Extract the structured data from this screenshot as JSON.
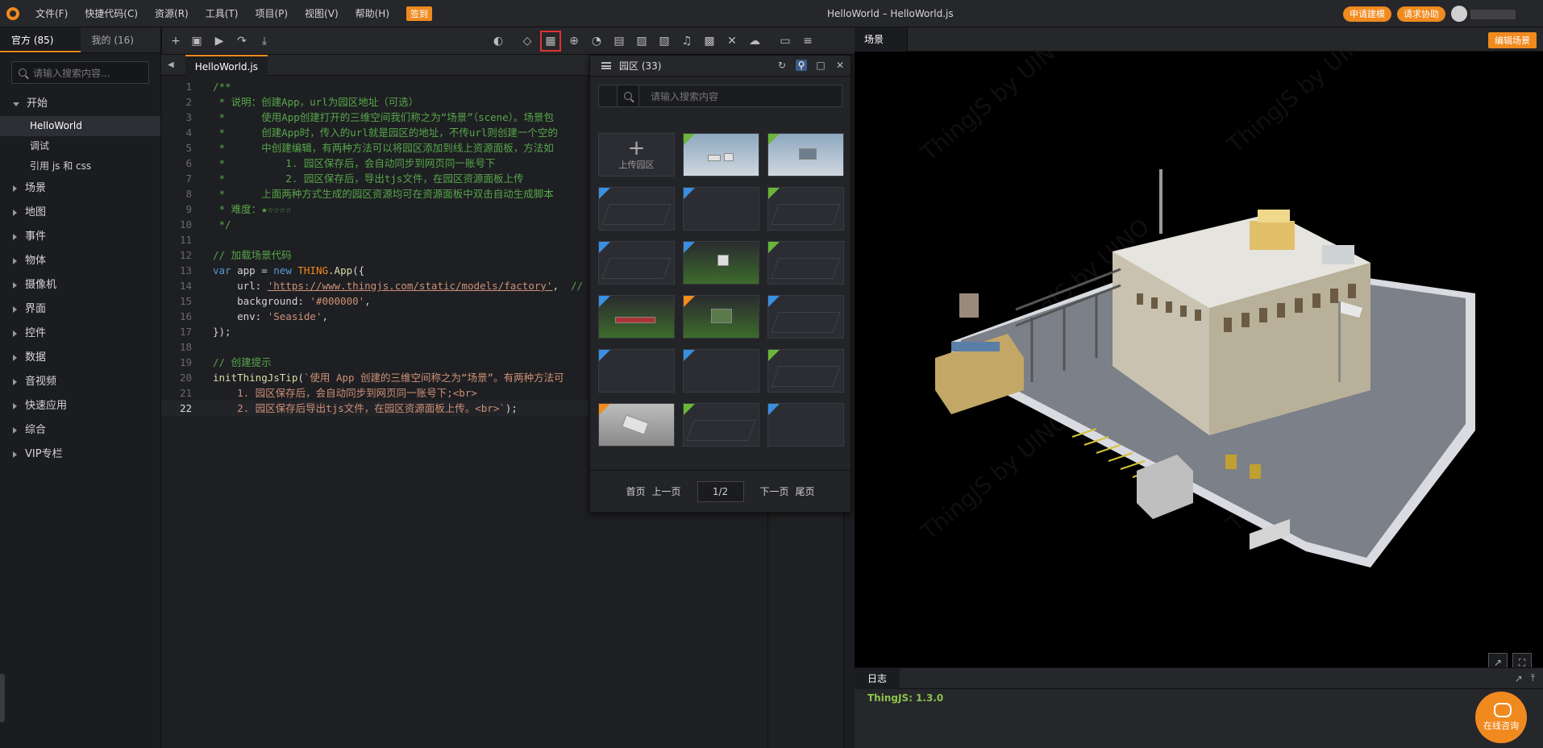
{
  "menubar": {
    "items": [
      "文件(F)",
      "快捷代码(C)",
      "资源(R)",
      "工具(T)",
      "项目(P)",
      "视图(V)",
      "帮助(H)"
    ],
    "signin": "签到",
    "title": "HelloWorld –  HelloWorld.js",
    "apply_build": "申请建模",
    "ask_help": "请求协助"
  },
  "sidebar": {
    "tabs": [
      "官方 (85)",
      "我的 (16)"
    ],
    "search_placeholder": "请输入搜索内容...",
    "start": "开始",
    "start_children": [
      "HelloWorld",
      "调试",
      "引用 js 和 css"
    ],
    "nodes": [
      "场景",
      "地图",
      "事件",
      "物体",
      "摄像机",
      "界面",
      "控件",
      "数据",
      "音视频",
      "快速应用",
      "综合",
      "VIP专栏"
    ]
  },
  "editor": {
    "file_tab": "HelloWorld.js"
  },
  "park": {
    "title": "园区 (33)",
    "search_placeholder": "请输入搜索内容",
    "upload_label": "上传园区",
    "first": "首页",
    "prev": "上一页",
    "page": "1/2",
    "next": "下一页",
    "last": "尾页"
  },
  "scene": {
    "tab": "场景",
    "edit_button": "编辑场景",
    "watermark": "ThingJS by UINO",
    "log_tab": "日志",
    "log_line": "ThingJS: 1.3.0"
  },
  "consult": {
    "label": "在线咨询"
  },
  "colors": {
    "accent": "#f08a1f",
    "comment": "#57a64a",
    "keyword": "#569cd6",
    "string": "#ce9178"
  }
}
